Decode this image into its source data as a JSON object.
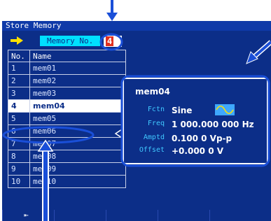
{
  "window": {
    "title": "Store Memory"
  },
  "memory_number": {
    "label": "Memory No.",
    "value": "4"
  },
  "list": {
    "headers": [
      "No.",
      "Name"
    ],
    "rows": [
      {
        "no": "1",
        "name": "mem01"
      },
      {
        "no": "2",
        "name": "mem02"
      },
      {
        "no": "3",
        "name": "mem03"
      },
      {
        "no": "4",
        "name": "mem04"
      },
      {
        "no": "5",
        "name": "mem05"
      },
      {
        "no": "6",
        "name": "mem06"
      },
      {
        "no": "7",
        "name": "mem07"
      },
      {
        "no": "8",
        "name": "mem08"
      },
      {
        "no": "9",
        "name": "mem09"
      },
      {
        "no": "10",
        "name": "mem10"
      }
    ],
    "selected_index": 3
  },
  "preview": {
    "name": "mem04",
    "function": {
      "label": "Fctn",
      "value": "Sine"
    },
    "frequency": {
      "label": "Freq",
      "value": "1 000.000 000 Hz"
    },
    "amplitude": {
      "label": "Amptd",
      "value": "0.100 0 Vp-p"
    },
    "offset": {
      "label": "Offset",
      "value": "+0.000 0 V"
    }
  },
  "softkeys": {
    "back_label": "⇤"
  },
  "colors": {
    "screen_bg": "#0c2e88",
    "highlight": "#00e0ff",
    "annotation": "#1a4fd8",
    "label": "#40c8ff",
    "value_box": "#e03020"
  },
  "icons": [
    "arrow-right-icon",
    "sine-wave-icon",
    "pointer-icon",
    "back-icon"
  ]
}
